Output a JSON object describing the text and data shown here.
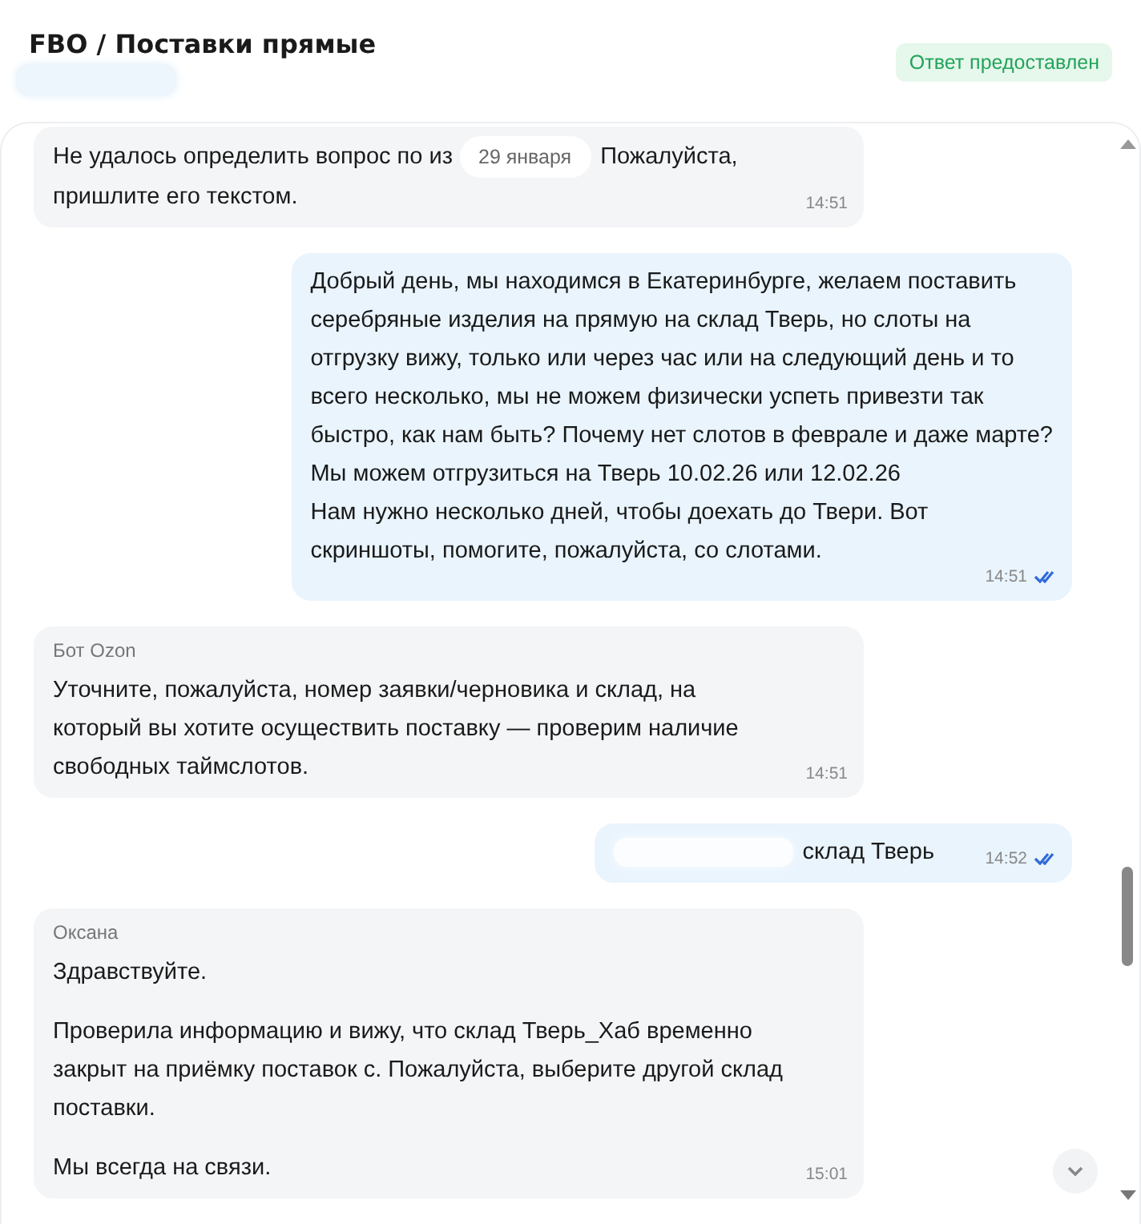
{
  "header": {
    "title": "FBO / Поставки прямые",
    "status": "Ответ предоставлен"
  },
  "date_chip": "29 января",
  "messages": [
    {
      "kind": "incoming",
      "text_before_chip": "Не удалось определить вопрос по из",
      "text_after_chip": "Пожалуйста,",
      "text_rest": "пришлите его текстом.",
      "time": "14:51"
    },
    {
      "kind": "outgoing",
      "text": "Добрый день, мы находимся в Екатеринбурге, желаем поставить\nсеребряные изделия на прямую на склад Тверь, но слоты на\nотгрузку вижу, только или через час или на следующий день и то\nвсего несколько, мы не можем физически успеть привезти так\nбыстро, как нам быть? Почему нет слотов в феврале и даже марте?\nМы можем отгрузиться на Тверь 10.02.26 или 12.02.26\nНам нужно несколько дней, чтобы доехать до Твери. Вот\nскриншоты, помогите, пожалуйста, со слотами.",
      "time": "14:51",
      "read": true
    },
    {
      "kind": "incoming",
      "author": "Бот Ozon",
      "text": "Уточните, пожалуйста, номер заявки/черновика и склад, на\nкоторый вы хотите осуществить поставку — проверим наличие\nсвободных таймслотов.",
      "time": "14:51"
    },
    {
      "kind": "outgoing",
      "redacted": true,
      "text": "склад Тверь",
      "time": "14:52",
      "read": true
    },
    {
      "kind": "incoming",
      "author": "Оксана",
      "paragraphs": [
        "Здравствуйте.",
        "Проверила информацию и вижу, что склад Тверь_Хаб временно\nзакрыт на приёмку поставок с. Пожалуйста, выберите другой склад\nпоставки.",
        "Мы всегда на связи."
      ],
      "time": "15:01"
    }
  ]
}
